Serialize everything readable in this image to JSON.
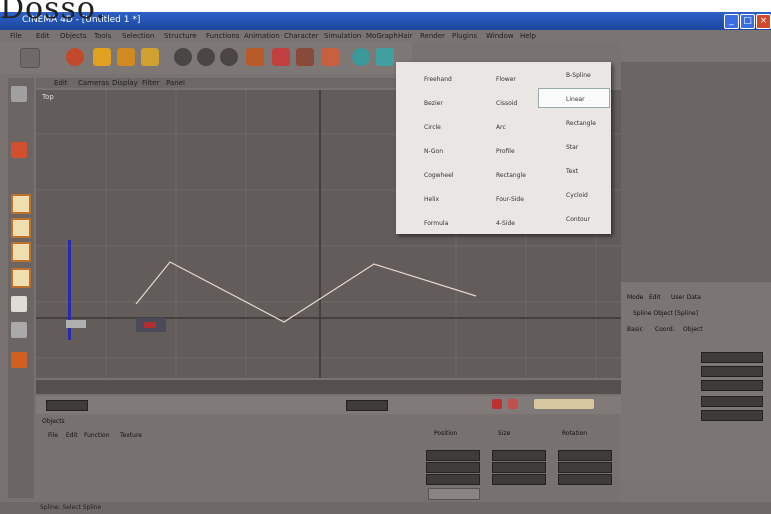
{
  "watermark": "Dosso.",
  "window": {
    "title": "CINEMA 4D - [Untitled 1 *]"
  },
  "menubar": [
    "File",
    "Edit",
    "Objects",
    "Tools",
    "Selection",
    "Structure",
    "Functions",
    "Animation",
    "Character",
    "Simulation",
    "MoGraph",
    "Hair",
    "Render",
    "Plugins",
    "Window",
    "Help"
  ],
  "viewport": {
    "menu": [
      "Edit",
      "Cameras",
      "Display",
      "Filter",
      "Panel"
    ],
    "label": "Top"
  },
  "popup": {
    "col1": [
      "Freehand",
      "Bezier",
      "Circle",
      "N-Gon",
      "Cogwheel",
      "Helix",
      "Formula"
    ],
    "col2": [
      "Flower",
      "Cissoid",
      "Arc",
      "Profile",
      "Rectangle",
      "Four-Side",
      "4-Side"
    ],
    "col3": [
      "B-Spline",
      "Linear",
      "Rectangle",
      "Star",
      "Text",
      "Cycloid",
      "Contour"
    ]
  },
  "attributes": {
    "mode": "Mode",
    "edit": "Edit",
    "user": "User Data",
    "object": "Spline Object [Spline]",
    "tabs": [
      "Basic",
      "Coord.",
      "Object"
    ]
  },
  "bottom_left": {
    "header": "Objects",
    "menu": [
      "File",
      "Edit",
      "Function",
      "Texture"
    ]
  },
  "bottom_right": {
    "headers": [
      "Position",
      "Size",
      "Rotation"
    ]
  },
  "status": "Spline: Select Spline"
}
